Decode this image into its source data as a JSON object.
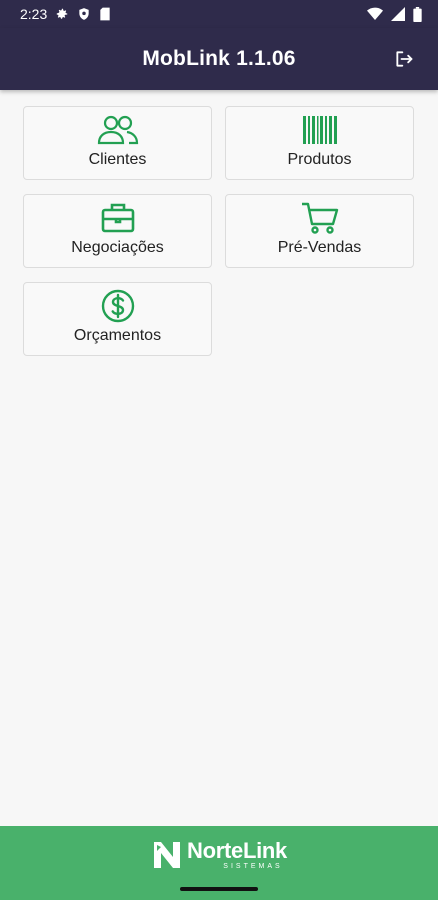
{
  "status_bar": {
    "time": "2:23",
    "left_icons": [
      "gear-icon",
      "shield-icon",
      "sim-card-icon"
    ],
    "right_icons": [
      "wifi-icon",
      "signal-icon",
      "battery-icon"
    ]
  },
  "app_bar": {
    "title": "MobLink 1.1.06",
    "logout_icon": "logout-icon"
  },
  "menu": [
    {
      "label": "Clientes",
      "icon": "users-icon"
    },
    {
      "label": "Produtos",
      "icon": "barcode-icon"
    },
    {
      "label": "Negociações",
      "icon": "briefcase-icon"
    },
    {
      "label": "Pré-Vendas",
      "icon": "cart-icon"
    },
    {
      "label": "Orçamentos",
      "icon": "dollar-icon"
    }
  ],
  "footer": {
    "brand": "NorteLink",
    "tagline": "SISTEMAS"
  },
  "colors": {
    "primary": "#2f2b4b",
    "accent": "#49b16b",
    "icon_green": "#22a052"
  }
}
